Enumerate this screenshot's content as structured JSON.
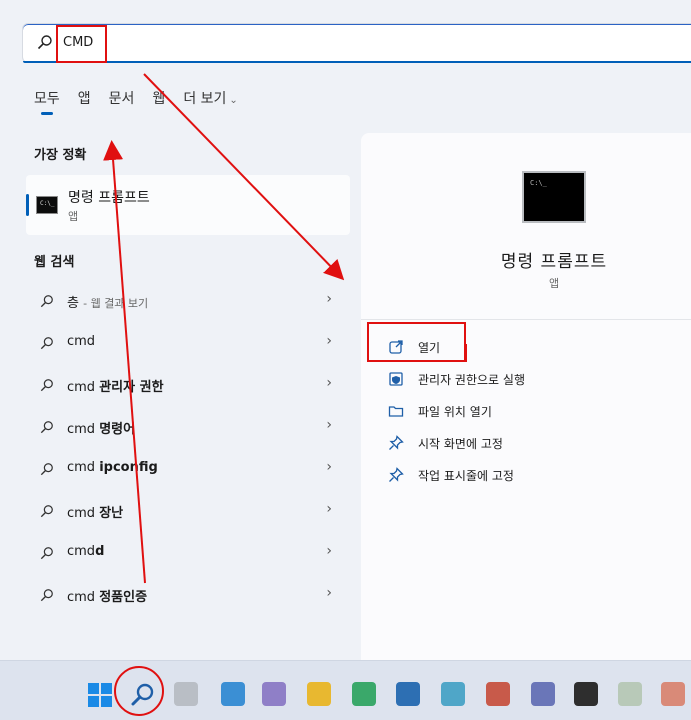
{
  "search": {
    "query": "CMD"
  },
  "tabs": [
    {
      "label": "모두"
    },
    {
      "label": "앱"
    },
    {
      "label": "문서"
    },
    {
      "label": "웹"
    },
    {
      "label": "더 보기"
    }
  ],
  "best_match": {
    "heading": "가장 정확",
    "title": "명령 프롬프트",
    "subtitle": "앱"
  },
  "web_search": {
    "heading": "웹 검색",
    "items": [
      {
        "prefix": "층",
        "bold": "",
        "suffix": "- 웹 결과 보기"
      },
      {
        "prefix": "cmd",
        "bold": "",
        "suffix": ""
      },
      {
        "prefix": "cmd ",
        "bold": "관리자 권한",
        "suffix": ""
      },
      {
        "prefix": "cmd ",
        "bold": "명령어",
        "suffix": ""
      },
      {
        "prefix": "cmd ",
        "bold": "ipconfig",
        "suffix": ""
      },
      {
        "prefix": "cmd ",
        "bold": "장난",
        "suffix": ""
      },
      {
        "prefix": "cmd",
        "bold": "d",
        "suffix": ""
      },
      {
        "prefix": "cmd ",
        "bold": "정품인증",
        "suffix": ""
      }
    ]
  },
  "preview": {
    "title": "명령 프롬프트",
    "subtitle": "앱",
    "actions": [
      {
        "label": "열기",
        "icon": "open-external-icon"
      },
      {
        "label": "관리자 권한으로 실행",
        "icon": "shield-icon"
      },
      {
        "label": "파일 위치 열기",
        "icon": "folder-icon"
      },
      {
        "label": "시작 화면에 고정",
        "icon": "pin-icon"
      },
      {
        "label": "작업 표시줄에 고정",
        "icon": "pin-icon"
      }
    ]
  },
  "colors": {
    "accent": "#005fb8",
    "annotation": "#e01010"
  }
}
